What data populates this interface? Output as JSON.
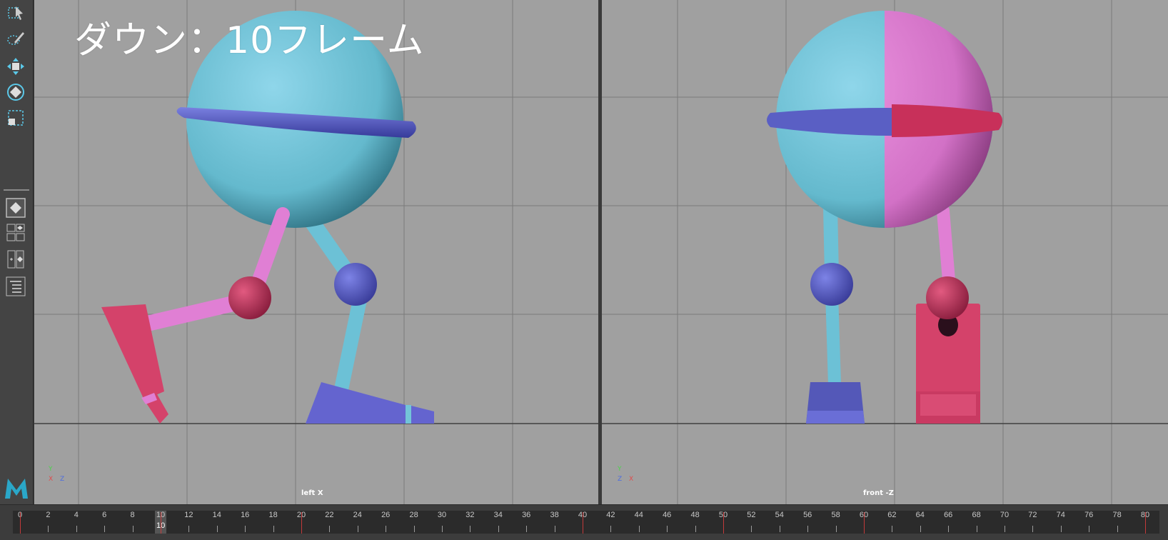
{
  "overlay": {
    "title": "ダウン：10フレーム"
  },
  "viewports": {
    "left": {
      "camera_label": "left X",
      "axis_up": "Y",
      "axis_a": "Z",
      "axis_b": "X"
    },
    "right": {
      "camera_label": "front -Z",
      "axis_up": "Y",
      "axis_a": "X",
      "axis_b": "Z"
    }
  },
  "timeline": {
    "range_start": 0,
    "range_end": 80,
    "current_frame": 10,
    "current_frame_label": "10",
    "tick_labels": [
      "0",
      "2",
      "4",
      "6",
      "8",
      "10",
      "12",
      "14",
      "16",
      "18",
      "20",
      "22",
      "24",
      "26",
      "28",
      "30",
      "32",
      "34",
      "36",
      "38",
      "40",
      "42",
      "44",
      "46",
      "48",
      "50",
      "52",
      "54",
      "56",
      "58",
      "60",
      "62",
      "64",
      "66",
      "68",
      "70",
      "72",
      "74",
      "76",
      "78",
      "80"
    ],
    "keyframes": [
      0,
      10,
      20,
      40,
      50,
      60,
      80
    ]
  },
  "colors": {
    "body": "#7cc9dc",
    "band": "#5a5fc4",
    "left_leg": "#e07fd4",
    "left_joint": "#c9365f",
    "right_leg": "#73c4d8",
    "right_joint": "#5b62c8",
    "foot_blue": "#6666cc",
    "foot_red": "#d4426a"
  },
  "toolbar": {
    "icons": [
      "select-tool-icon",
      "lasso-tool-icon",
      "move-tool-icon",
      "rotate-tool-icon",
      "scale-tool-icon",
      "layout-single-icon",
      "layout-four-icon",
      "layout-two-icon",
      "outliner-icon",
      "maya-logo-icon"
    ]
  }
}
